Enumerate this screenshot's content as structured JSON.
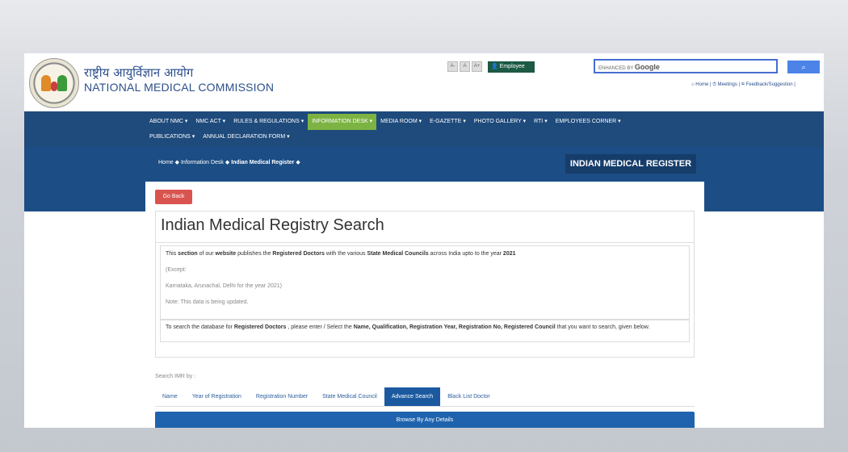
{
  "header": {
    "title_hindi": "राष्ट्रीय आयुर्विज्ञान आयोग",
    "title_english": "NATIONAL MEDICAL COMMISSION",
    "font_buttons": [
      "A-",
      "A",
      "A+"
    ],
    "employee_label": "Employee",
    "search_placeholder_prefix": "ENHANCED BY",
    "search_placeholder_brand": "Google",
    "search_button_icon": "search-icon",
    "top_links": "⌂ Home | ⏱ Meetings | ✉ Feedback/Suggestion |"
  },
  "nav": {
    "row1": [
      "ABOUT NMC ▾",
      "NMC ACT ▾",
      "RULES & REGULATIONS ▾",
      "INFORMATION DESK ▾",
      "MEDIA ROOM ▾",
      "E-GAZETTE ▾",
      "PHOTO GALLERY ▾",
      "RTI ▾",
      "EMPLOYEES CORNER ▾"
    ],
    "row2": [
      "PUBLICATIONS ▾",
      "ANNUAL DECLARATION FORM ▾"
    ],
    "active": "INFORMATION DESK ▾"
  },
  "breadcrumb": {
    "home": "Home",
    "sep": "◆",
    "info_desk": "Information Desk",
    "current": "Indian Medical Register"
  },
  "page_tag": "INDIAN MEDICAL REGISTER",
  "main": {
    "go_back": "Go Back",
    "heading": "Indian Medical Registry Search",
    "line1_pre": "This ",
    "line1_b1": "section",
    "line1_m1": " of our ",
    "line1_b2": "website",
    "line1_m2": " publishes the ",
    "line1_b3": "Registered Doctors",
    "line1_m3": " with the various ",
    "line1_b4": "State Medical Councils",
    "line1_m4": " across India upto to the year ",
    "line1_b5": "2021",
    "except": "(Except:",
    "states": "Karnataka, Arunachal, Delhi for the year 2021)",
    "note": "Note: This data is being updated.",
    "line2_pre": "To search the database for ",
    "line2_b1": "Registered Doctors",
    "line2_m1": " , please enter / Select the ",
    "line2_b2": "Name, Qualification, Registration Year, Registration No, Registered Council",
    "line2_m2": " that you want to search, given below.",
    "search_by": "Search IMR by :",
    "tabs": [
      "Name",
      "Year of Registration",
      "Registration Number",
      "State Medical Council",
      "Advance Search",
      "Black List Doctor"
    ],
    "selected_tab": "Advance Search",
    "browse": "Browse By Any Details"
  },
  "colors": {
    "nav_bg": "#1e4a7c",
    "active_nav": "#7cb342",
    "go_back": "#d9534f",
    "tab_selected": "#1c5aa0"
  }
}
